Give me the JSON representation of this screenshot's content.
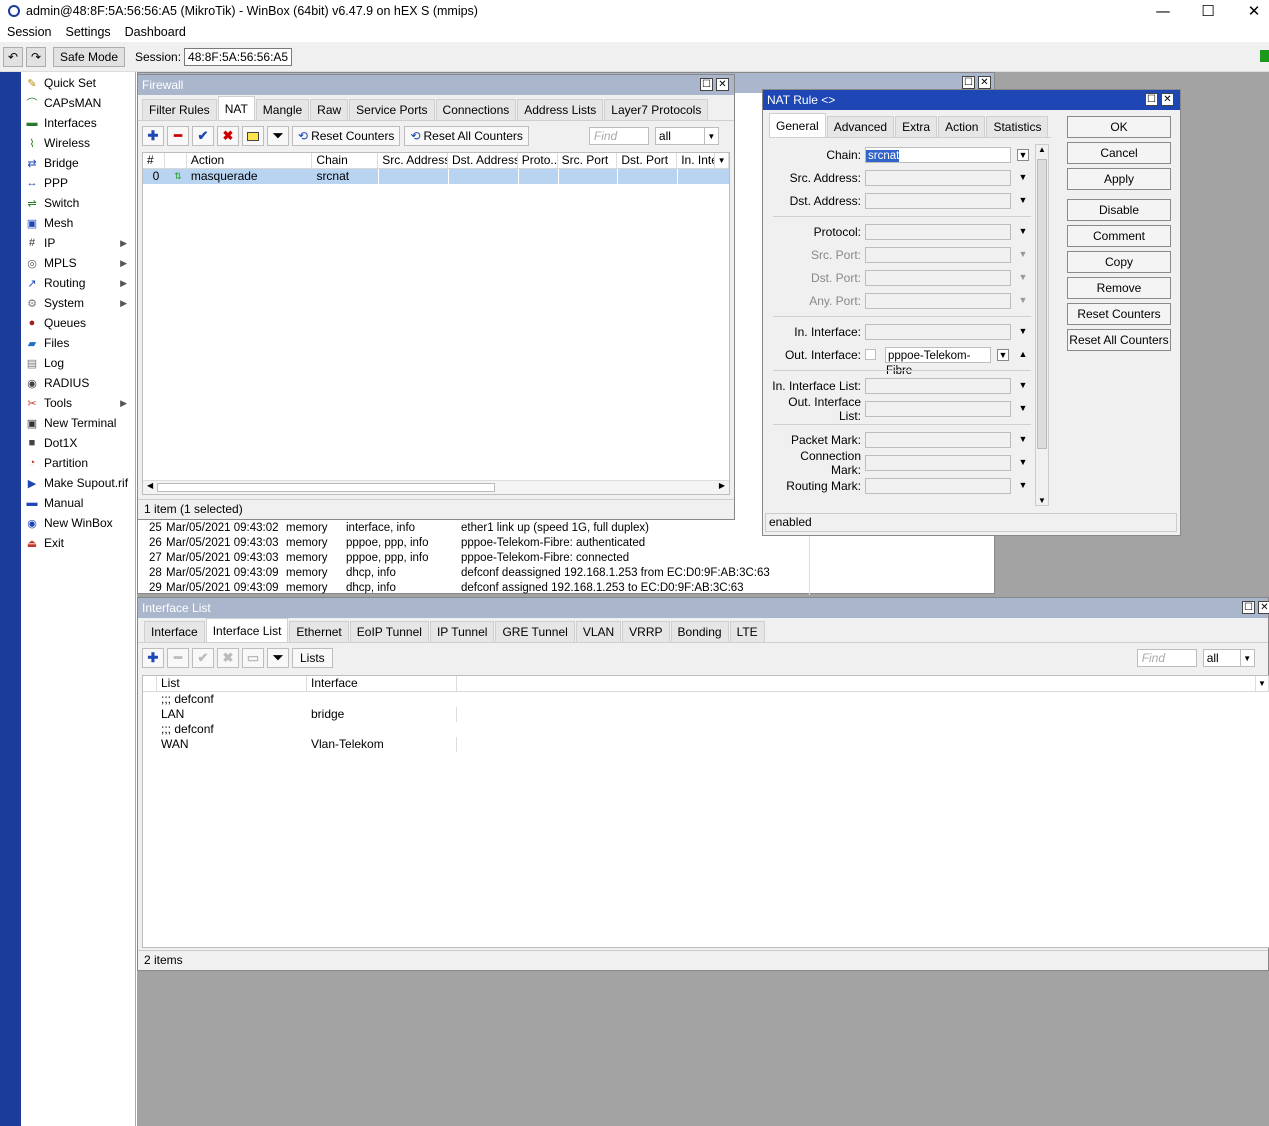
{
  "window": {
    "title": "admin@48:8F:5A:56:56:A5 (MikroTik) - WinBox (64bit) v6.47.9 on hEX S (mmips)",
    "minimize": "—",
    "maximize": "☐",
    "close": "✕"
  },
  "menu": [
    "Session",
    "Settings",
    "Dashboard"
  ],
  "toolbar": {
    "undo": "↶",
    "redo": "↷",
    "safe_mode": "Safe Mode",
    "session_label": "Session:",
    "session_value": "48:8F:5A:56:56:A5"
  },
  "sidebar": [
    {
      "label": "Quick Set",
      "icon": "quick-set-icon",
      "sub": false
    },
    {
      "label": "CAPsMAN",
      "icon": "capsman-icon",
      "sub": false
    },
    {
      "label": "Interfaces",
      "icon": "interfaces-icon",
      "sub": false
    },
    {
      "label": "Wireless",
      "icon": "wireless-icon",
      "sub": false
    },
    {
      "label": "Bridge",
      "icon": "bridge-icon",
      "sub": false
    },
    {
      "label": "PPP",
      "icon": "ppp-icon",
      "sub": false
    },
    {
      "label": "Switch",
      "icon": "switch-icon",
      "sub": false
    },
    {
      "label": "Mesh",
      "icon": "mesh-icon",
      "sub": false
    },
    {
      "label": "IP",
      "icon": "ip-icon",
      "sub": true
    },
    {
      "label": "MPLS",
      "icon": "mpls-icon",
      "sub": true
    },
    {
      "label": "Routing",
      "icon": "routing-icon",
      "sub": true
    },
    {
      "label": "System",
      "icon": "system-icon",
      "sub": true
    },
    {
      "label": "Queues",
      "icon": "queues-icon",
      "sub": false
    },
    {
      "label": "Files",
      "icon": "files-icon",
      "sub": false
    },
    {
      "label": "Log",
      "icon": "log-icon",
      "sub": false
    },
    {
      "label": "RADIUS",
      "icon": "radius-icon",
      "sub": false
    },
    {
      "label": "Tools",
      "icon": "tools-icon",
      "sub": true
    },
    {
      "label": "New Terminal",
      "icon": "terminal-icon",
      "sub": false
    },
    {
      "label": "Dot1X",
      "icon": "dot1x-icon",
      "sub": false
    },
    {
      "label": "Partition",
      "icon": "partition-icon",
      "sub": false
    },
    {
      "label": "Make Supout.rif",
      "icon": "supout-icon",
      "sub": false
    },
    {
      "label": "Manual",
      "icon": "manual-icon",
      "sub": false
    },
    {
      "label": "New WinBox",
      "icon": "winbox-icon",
      "sub": false
    },
    {
      "label": "Exit",
      "icon": "exit-icon",
      "sub": false
    }
  ],
  "log": {
    "rows": [
      {
        "n": "25",
        "time": "Mar/05/2021 09:43:02",
        "buffer": "memory",
        "topics": "interface, info",
        "message": "ether1 link up (speed 1G, full duplex)"
      },
      {
        "n": "26",
        "time": "Mar/05/2021 09:43:03",
        "buffer": "memory",
        "topics": "pppoe, ppp, info",
        "message": "pppoe-Telekom-Fibre: authenticated"
      },
      {
        "n": "27",
        "time": "Mar/05/2021 09:43:03",
        "buffer": "memory",
        "topics": "pppoe, ppp, info",
        "message": "pppoe-Telekom-Fibre: connected"
      },
      {
        "n": "28",
        "time": "Mar/05/2021 09:43:09",
        "buffer": "memory",
        "topics": "dhcp, info",
        "message": "defconf deassigned 192.168.1.253 from EC:D0:9F:AB:3C:63"
      },
      {
        "n": "29",
        "time": "Mar/05/2021 09:43:09",
        "buffer": "memory",
        "topics": "dhcp, info",
        "message": "defconf assigned 192.168.1.253 to EC:D0:9F:AB:3C:63"
      }
    ]
  },
  "firewall": {
    "title": "Firewall",
    "tabs": [
      "Filter Rules",
      "NAT",
      "Mangle",
      "Raw",
      "Service Ports",
      "Connections",
      "Address Lists",
      "Layer7 Protocols"
    ],
    "active_tab": 1,
    "reset_counters": "Reset Counters",
    "reset_all_counters": "Reset All Counters",
    "find_placeholder": "Find",
    "filter_value": "all",
    "columns": [
      "#",
      "Action",
      "Chain",
      "Src. Address",
      "Dst. Address",
      "Proto...",
      "Src. Port",
      "Dst. Port",
      "In. Inte"
    ],
    "rows": [
      {
        "n": "0",
        "action": "masquerade",
        "chain": "srcnat"
      }
    ],
    "status": "1 item (1 selected)"
  },
  "nat_rule": {
    "title": "NAT Rule <>",
    "tabs": [
      "General",
      "Advanced",
      "Extra",
      "Action",
      "Statistics"
    ],
    "fields": [
      {
        "label": "Chain:",
        "value": "srcnat",
        "enabled": true
      },
      {
        "label": "Src. Address:",
        "value": "",
        "enabled": true
      },
      {
        "label": "Dst. Address:",
        "value": "",
        "enabled": true
      },
      {
        "label": "Protocol:",
        "value": "",
        "enabled": true
      },
      {
        "label": "Src. Port:",
        "value": "",
        "enabled": false
      },
      {
        "label": "Dst. Port:",
        "value": "",
        "enabled": false
      },
      {
        "label": "Any. Port:",
        "value": "",
        "enabled": false
      },
      {
        "label": "In. Interface:",
        "value": "",
        "enabled": true
      },
      {
        "label": "Out. Interface:",
        "value": "pppoe-Telekom-Fibre",
        "enabled": true
      },
      {
        "label": "In. Interface List:",
        "value": "",
        "enabled": true
      },
      {
        "label": "Out. Interface List:",
        "value": "",
        "enabled": true
      },
      {
        "label": "Packet Mark:",
        "value": "",
        "enabled": true
      },
      {
        "label": "Connection Mark:",
        "value": "",
        "enabled": true
      },
      {
        "label": "Routing Mark:",
        "value": "",
        "enabled": true
      }
    ],
    "buttons": [
      "OK",
      "Cancel",
      "Apply",
      "Disable",
      "Comment",
      "Copy",
      "Remove",
      "Reset Counters",
      "Reset All Counters"
    ],
    "status": "enabled"
  },
  "interface_list": {
    "title": "Interface List",
    "tabs": [
      "Interface",
      "Interface List",
      "Ethernet",
      "EoIP Tunnel",
      "IP Tunnel",
      "GRE Tunnel",
      "VLAN",
      "VRRP",
      "Bonding",
      "LTE"
    ],
    "active_tab": 1,
    "lists_button": "Lists",
    "find_placeholder": "Find",
    "filter_value": "all",
    "columns": [
      "List",
      "Interface"
    ],
    "rows": [
      {
        "comment": ";;; defconf",
        "list": "LAN",
        "interface": "bridge"
      },
      {
        "comment": ";;; defconf",
        "list": "WAN",
        "interface": "Vlan-Telekom"
      }
    ],
    "status": "2 items"
  },
  "colors": {
    "sidebar_strip": "#1c3c9b",
    "active_title": "#1e46b4",
    "inactive_title": "#a9b6cc",
    "selection": "#b9d4f1",
    "desktop": "#a3a3a3"
  }
}
